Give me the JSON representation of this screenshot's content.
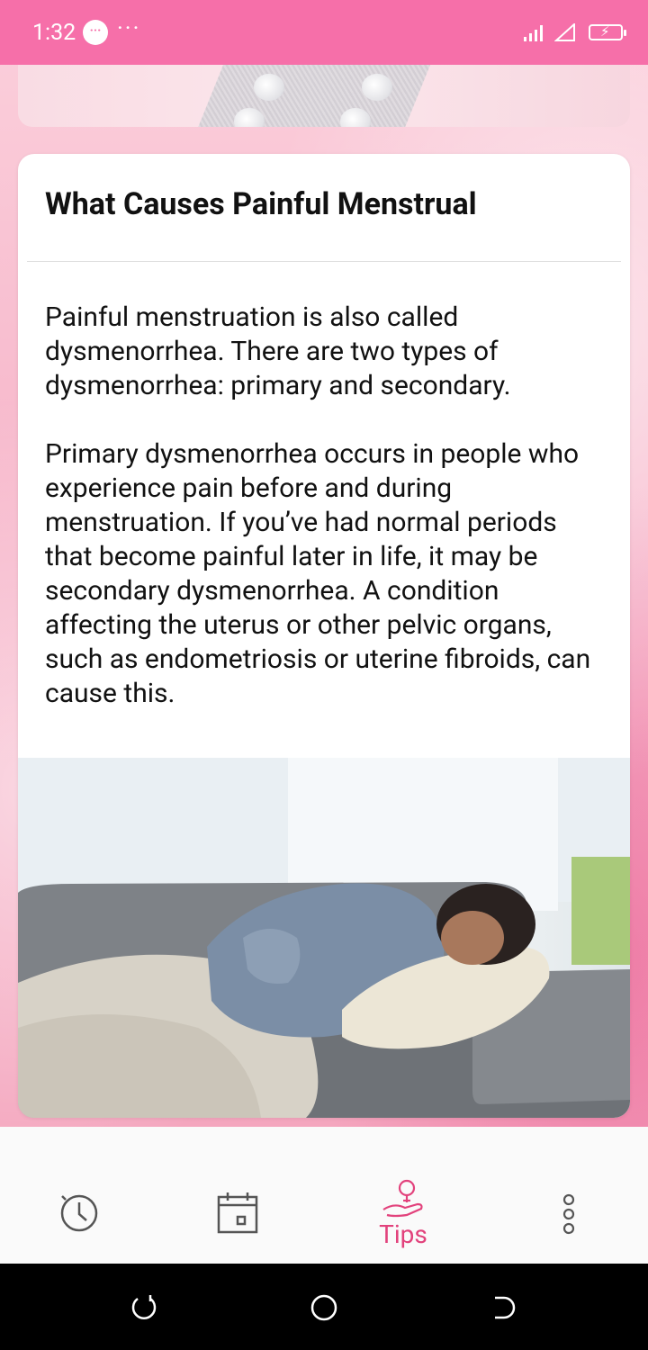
{
  "status_bar": {
    "time": "1:32",
    "message_icon": "chat-bubble-icon",
    "more": "···",
    "signal_icon": "signal-icon",
    "wifi_icon": "wifi-icon",
    "battery_icon": "battery-charging-icon"
  },
  "article": {
    "title": "What Causes Painful Menstrual",
    "body": "Painful menstruation is also called dysmenorrhea. There are two types of dysmenorrhea: primary and secondary.\n\nPrimary dysmenorrhea occurs in people who experience pain before and during menstruation. If you’ve had normal periods that become painful later in life, it may be secondary dysmenorrhea. A condition affecting the uterus or other pelvic organs, such as endometriosis or uterine fibroids, can cause this."
  },
  "tab_bar": {
    "tabs": [
      {
        "icon": "history-clock-icon",
        "label": ""
      },
      {
        "icon": "calendar-icon",
        "label": ""
      },
      {
        "icon": "lightbulb-hand-icon",
        "label": "Tips",
        "active": true
      },
      {
        "icon": "more-vertical-icon",
        "label": ""
      }
    ]
  },
  "colors": {
    "status_bar": "#f66fa9",
    "accent": "#e2427c",
    "background": "#f7b9cc"
  }
}
